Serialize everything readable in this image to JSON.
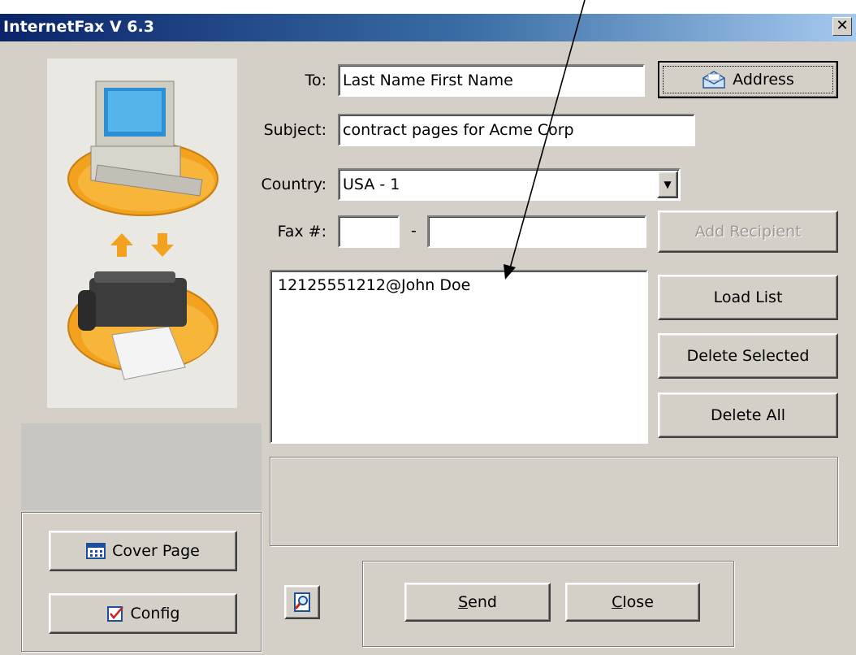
{
  "window": {
    "title": "InternetFax V 6.3"
  },
  "form": {
    "to_label": "To:",
    "to_value": "Last Name First Name",
    "subject_label": "Subject:",
    "subject_value": "contract pages for Acme Corp",
    "country_label": "Country:",
    "country_value": "USA - 1",
    "fax_label": "Fax #:",
    "fax_dash": "-",
    "fax_area_value": "",
    "fax_number_value": ""
  },
  "buttons": {
    "address": "Address",
    "add_recipient": "Add Recipient",
    "load_list": "Load List",
    "delete_selected": "Delete Selected",
    "delete_all": "Delete All",
    "cover_page": "Cover Page",
    "config": "Config",
    "send_first": "S",
    "send_rest": "end",
    "close_first": "C",
    "close_rest": "lose"
  },
  "recipients": [
    "12125551212@John Doe"
  ],
  "icons": {
    "address": "envelope-icon",
    "cover_page": "grid-icon",
    "config": "checklist-icon",
    "preview": "magnifier-page-icon",
    "close": "close-icon",
    "dropdown": "dropdown-arrow-icon"
  },
  "colors": {
    "titlebar_start": "#0a246a",
    "titlebar_end": "#a6caf0",
    "window_bg": "#d4d0c8",
    "orange": "#f2a21e"
  }
}
